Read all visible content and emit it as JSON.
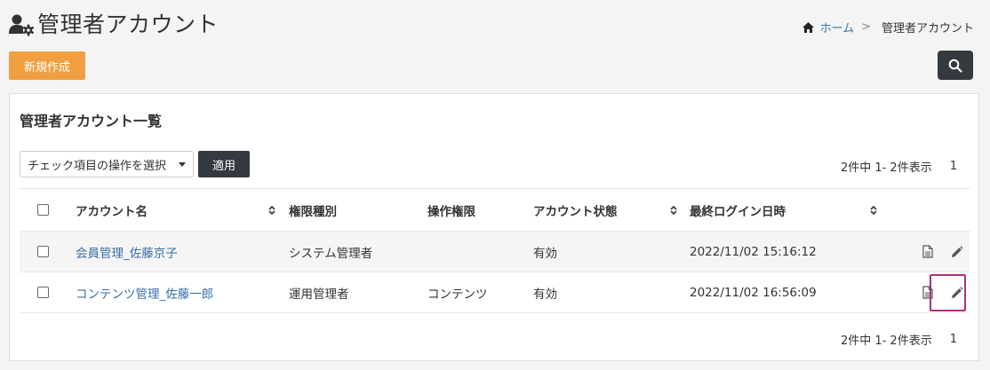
{
  "page": {
    "title": "管理者アカウント",
    "breadcrumb": {
      "home": "ホーム",
      "separator": ">",
      "current": "管理者アカウント"
    }
  },
  "toolbar": {
    "new_label": "新規作成"
  },
  "card": {
    "title": "管理者アカウント一覧",
    "bulk_select_label": "チェック項目の操作を選択",
    "apply_label": "適用",
    "pager_summary": "2件中 1- 2件表示",
    "pager_page": "1"
  },
  "table": {
    "columns": [
      "アカウント名",
      "権限種別",
      "操作権限",
      "アカウント状態",
      "最終ログイン日時"
    ],
    "rows": [
      {
        "name": "会員管理_佐藤京子",
        "role": "システム管理者",
        "permission": "",
        "status": "有効",
        "last_login": "2022/11/02 15:16:12"
      },
      {
        "name": "コンテンツ管理_佐藤一郎",
        "role": "運用管理者",
        "permission": "コンテンツ",
        "status": "有効",
        "last_login": "2022/11/02 16:56:09"
      }
    ]
  },
  "icons": {
    "title": "user-gear-icon",
    "home": "home-icon",
    "search": "search-icon",
    "sort": "sort-icon",
    "document": "document-icon",
    "edit": "pencil-icon"
  },
  "colors": {
    "accent": "#f0a040",
    "dark_button": "#343a40",
    "link": "#3a6ea5",
    "highlight": "#b0307a"
  }
}
